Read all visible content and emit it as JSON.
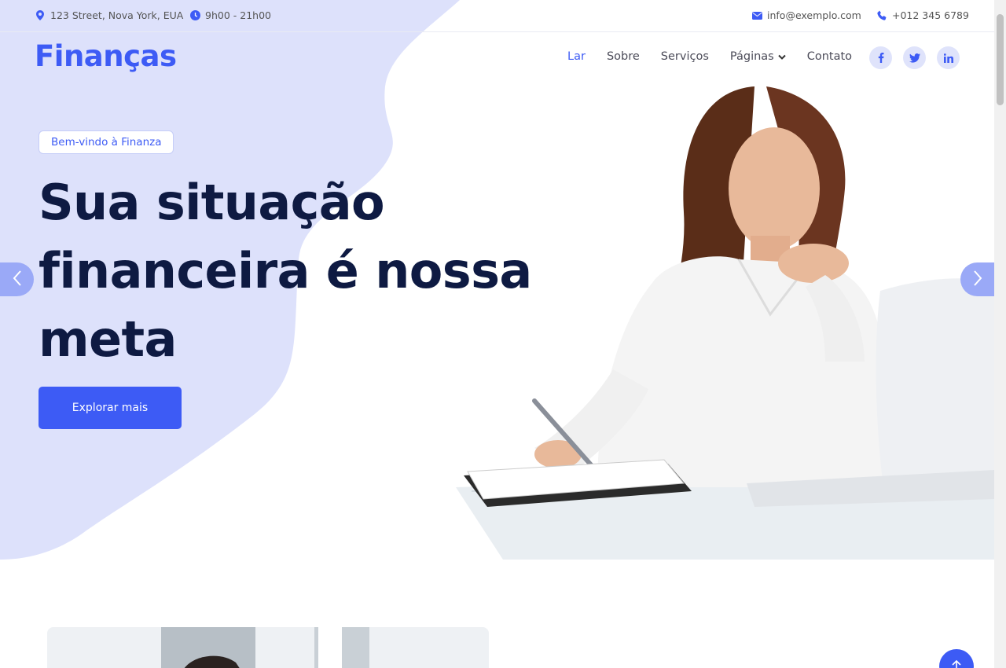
{
  "topbar": {
    "address": "123 Street, Nova York, EUA",
    "hours": "9h00 - 21h00",
    "email": "info@exemplo.com",
    "phone": "+012 345 6789"
  },
  "brand": {
    "logo": "Finanças"
  },
  "nav": {
    "items": [
      {
        "label": "Lar",
        "active": true
      },
      {
        "label": "Sobre"
      },
      {
        "label": "Serviços"
      },
      {
        "label": "Páginas",
        "dropdown": true
      },
      {
        "label": "Contato"
      }
    ]
  },
  "social": [
    {
      "icon": "facebook-icon",
      "glyph": "f"
    },
    {
      "icon": "twitter-icon",
      "glyph": "t"
    },
    {
      "icon": "linkedin-icon",
      "glyph": "in"
    }
  ],
  "hero": {
    "badge": "Bem-vindo à Finanza",
    "headline": "Sua situação financeira é nossa meta",
    "cta": "Explorar mais"
  },
  "colors": {
    "accent": "#3d5bf5",
    "blob": "#dde1fb",
    "heading": "#0e1a42",
    "arrow": "#9aa9f7"
  }
}
